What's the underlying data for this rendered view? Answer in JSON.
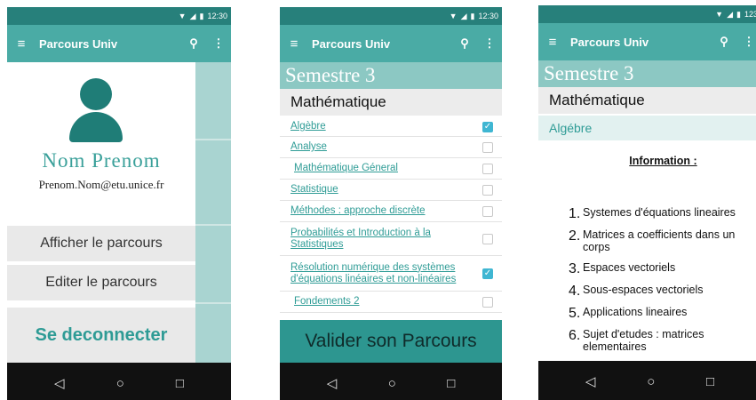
{
  "app": {
    "status_time": "12:30",
    "status_time_cropped": "123",
    "toolbar_title": "Parcours Univ"
  },
  "icons": {
    "menu": "hamburger-icon",
    "search": "search-icon",
    "overflow": "overflow-menu-icon",
    "back": "back-triangle-icon",
    "home": "home-circle-icon",
    "recents": "recents-square-icon"
  },
  "colors": {
    "primary": "#4aaba5",
    "primary_dark": "#27807b",
    "accent_text": "#2f9c96",
    "checkbox_checked": "#3fb6d2",
    "semester_bg": "#8cc8c3"
  },
  "drawer": {
    "name": "Nom Prenom",
    "email": "Prenom.Nom@etu.unice.fr",
    "view_path": "Afficher le parcours",
    "edit_path": "Editer le parcours",
    "logout": "Se deconnecter"
  },
  "courses_screen": {
    "semester": "Semestre 3",
    "subject": "Mathématique",
    "courses": [
      {
        "label": "Algèbre",
        "checked": true
      },
      {
        "label": "Analyse",
        "checked": false
      },
      {
        "label": "Mathématique Géneral",
        "checked": false
      },
      {
        "label": "Statistique",
        "checked": false
      },
      {
        "label": "Méthodes : approche discrète",
        "checked": false
      },
      {
        "label": "Probabilités et Introduction à la Statistiques",
        "checked": false
      },
      {
        "label": "Résolution numérique des systèmes d'équations linéaires et non-linéaires",
        "checked": true
      },
      {
        "label": "Fondements 2",
        "checked": false
      }
    ],
    "validate": "Valider son Parcours"
  },
  "info_screen": {
    "semester": "Semestre 3",
    "subject": "Mathématique",
    "course": "Algébre",
    "info_title": "Information :",
    "items": [
      {
        "num": "1.",
        "text": "Systemes d'équations lineaires"
      },
      {
        "num": "2.",
        "text": "Matrices a coefficients dans un corps"
      },
      {
        "num": "3.",
        "text": "Espaces vectoriels"
      },
      {
        "num": "4.",
        "text": "Sous-espaces vectoriels"
      },
      {
        "num": "5.",
        "text": "Applications lineaires"
      },
      {
        "num": "6.",
        "text": "Sujet d'etudes : matrices elementaires"
      }
    ]
  }
}
